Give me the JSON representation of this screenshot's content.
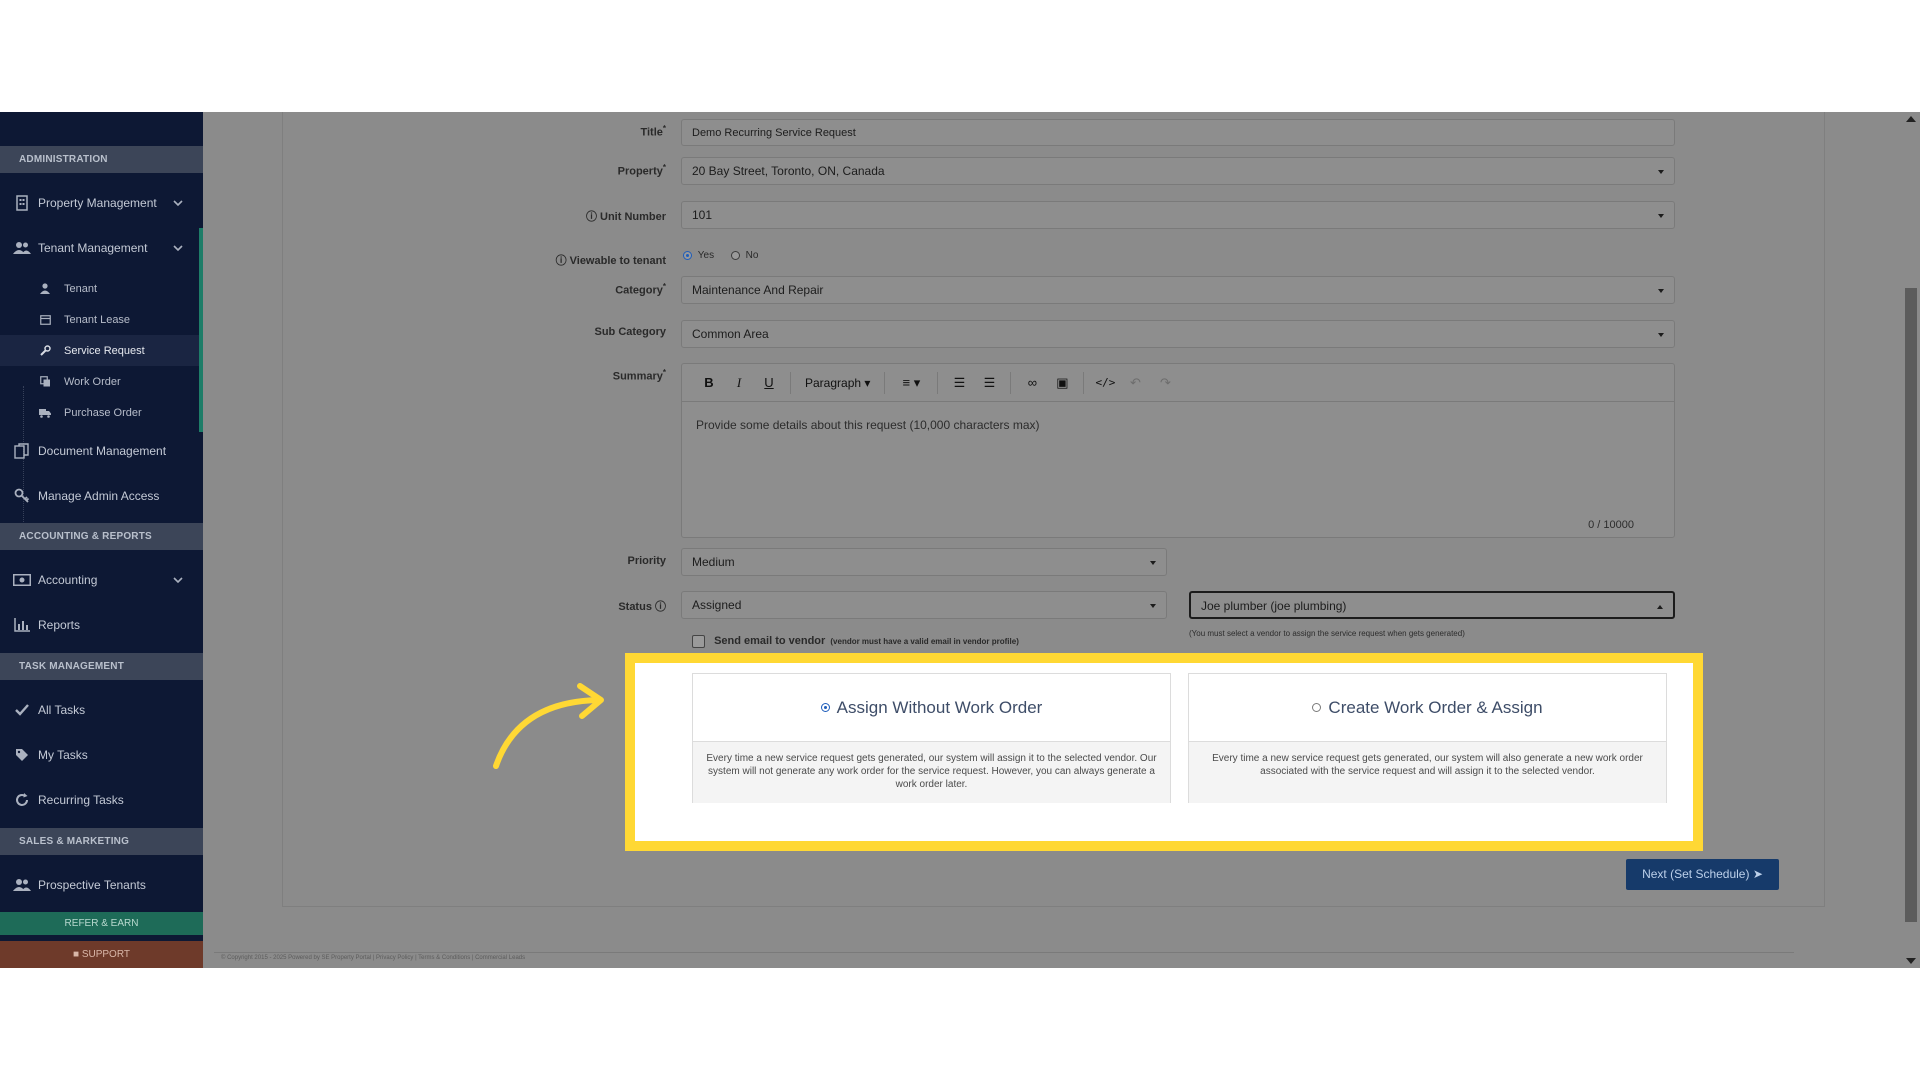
{
  "sidebar": {
    "headers": {
      "administration": "ADMINISTRATION",
      "accounting": "ACCOUNTING & REPORTS",
      "task": "TASK MANAGEMENT",
      "sales": "SALES & MARKETING"
    },
    "items": {
      "property_management": "Property Management",
      "tenant_management": "Tenant Management",
      "document_management": "Document Management",
      "manage_admin_access": "Manage Admin Access",
      "accounting": "Accounting",
      "reports": "Reports",
      "all_tasks": "All Tasks",
      "my_tasks": "My Tasks",
      "recurring_tasks": "Recurring Tasks",
      "prospective_tenants": "Prospective Tenants"
    },
    "sub_items": {
      "tenant": "Tenant",
      "tenant_lease": "Tenant Lease",
      "service_request": "Service Request",
      "work_order": "Work Order",
      "purchase_order": "Purchase Order"
    },
    "refer_label": "REFER & EARN",
    "support_label": "SUPPORT"
  },
  "form": {
    "title_label": "Title",
    "title_value": "Demo Recurring Service Request",
    "property_label": "Property",
    "property_value": "20 Bay Street, Toronto, ON, Canada",
    "unit_label": "Unit Number",
    "unit_value": "101",
    "viewable_label": "Viewable to tenant",
    "viewable_yes": "Yes",
    "viewable_no": "No",
    "category_label": "Category",
    "category_value": "Maintenance And Repair",
    "subcategory_label": "Sub Category",
    "subcategory_value": "Common Area",
    "summary_label": "Summary",
    "summary_placeholder": "Provide some details about this request (10,000 characters max)",
    "summary_count": "0 / 10000",
    "toolbar_paragraph": "Paragraph",
    "priority_label": "Priority",
    "priority_value": "Medium",
    "status_label": "Status",
    "status_value": "Assigned",
    "vendor_value": "Joe plumber (joe plumbing)",
    "vendor_hint": "(You must select a vendor to assign the service request when gets generated)",
    "send_email_label": "Send email to vendor",
    "send_email_hint": "(vendor must have a valid email in vendor profile)"
  },
  "options": {
    "assign_without": {
      "title": "Assign Without Work Order",
      "description": "Every time a new service request gets generated, our system will assign it to the selected vendor. Our system will not generate any work order for the service request. However, you can always generate a work order later.",
      "selected": true
    },
    "create_work_order": {
      "title": "Create Work Order & Assign",
      "description": "Every time a new service request gets generated, our system will also generate a new work order associated with the service request and will assign it to the selected vendor.",
      "selected": false
    }
  },
  "next_button": "Next (Set Schedule)",
  "footer_text": "© Copyright 2015 - 2025 Powered by SE Property Portal | Privacy Policy | Terms & Conditions | Commercial Leads",
  "colors": {
    "highlight": "#ffd834",
    "sidebar_bg": "#0d1834",
    "accent_green": "#1e7d68",
    "primary_button": "#163a6a",
    "arrow": "#ffd834"
  }
}
